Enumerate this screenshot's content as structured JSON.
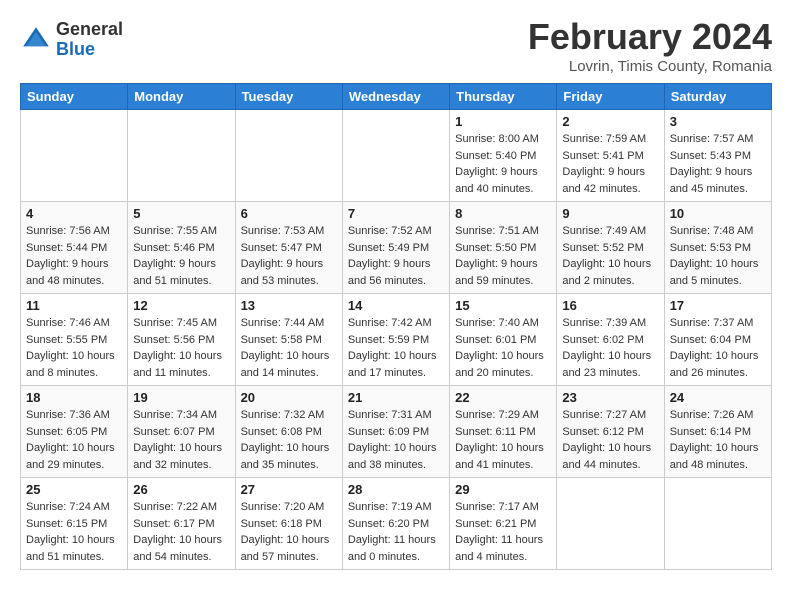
{
  "header": {
    "logo_general": "General",
    "logo_blue": "Blue",
    "title": "February 2024",
    "location": "Lovrin, Timis County, Romania"
  },
  "calendar": {
    "days_of_week": [
      "Sunday",
      "Monday",
      "Tuesday",
      "Wednesday",
      "Thursday",
      "Friday",
      "Saturday"
    ],
    "rows": [
      {
        "cells": [
          {
            "empty": true
          },
          {
            "empty": true
          },
          {
            "empty": true
          },
          {
            "empty": true
          },
          {
            "day": "1",
            "sunrise": "Sunrise: 8:00 AM",
            "sunset": "Sunset: 5:40 PM",
            "daylight": "Daylight: 9 hours and 40 minutes."
          },
          {
            "day": "2",
            "sunrise": "Sunrise: 7:59 AM",
            "sunset": "Sunset: 5:41 PM",
            "daylight": "Daylight: 9 hours and 42 minutes."
          },
          {
            "day": "3",
            "sunrise": "Sunrise: 7:57 AM",
            "sunset": "Sunset: 5:43 PM",
            "daylight": "Daylight: 9 hours and 45 minutes."
          }
        ]
      },
      {
        "cells": [
          {
            "day": "4",
            "sunrise": "Sunrise: 7:56 AM",
            "sunset": "Sunset: 5:44 PM",
            "daylight": "Daylight: 9 hours and 48 minutes."
          },
          {
            "day": "5",
            "sunrise": "Sunrise: 7:55 AM",
            "sunset": "Sunset: 5:46 PM",
            "daylight": "Daylight: 9 hours and 51 minutes."
          },
          {
            "day": "6",
            "sunrise": "Sunrise: 7:53 AM",
            "sunset": "Sunset: 5:47 PM",
            "daylight": "Daylight: 9 hours and 53 minutes."
          },
          {
            "day": "7",
            "sunrise": "Sunrise: 7:52 AM",
            "sunset": "Sunset: 5:49 PM",
            "daylight": "Daylight: 9 hours and 56 minutes."
          },
          {
            "day": "8",
            "sunrise": "Sunrise: 7:51 AM",
            "sunset": "Sunset: 5:50 PM",
            "daylight": "Daylight: 9 hours and 59 minutes."
          },
          {
            "day": "9",
            "sunrise": "Sunrise: 7:49 AM",
            "sunset": "Sunset: 5:52 PM",
            "daylight": "Daylight: 10 hours and 2 minutes."
          },
          {
            "day": "10",
            "sunrise": "Sunrise: 7:48 AM",
            "sunset": "Sunset: 5:53 PM",
            "daylight": "Daylight: 10 hours and 5 minutes."
          }
        ]
      },
      {
        "cells": [
          {
            "day": "11",
            "sunrise": "Sunrise: 7:46 AM",
            "sunset": "Sunset: 5:55 PM",
            "daylight": "Daylight: 10 hours and 8 minutes."
          },
          {
            "day": "12",
            "sunrise": "Sunrise: 7:45 AM",
            "sunset": "Sunset: 5:56 PM",
            "daylight": "Daylight: 10 hours and 11 minutes."
          },
          {
            "day": "13",
            "sunrise": "Sunrise: 7:44 AM",
            "sunset": "Sunset: 5:58 PM",
            "daylight": "Daylight: 10 hours and 14 minutes."
          },
          {
            "day": "14",
            "sunrise": "Sunrise: 7:42 AM",
            "sunset": "Sunset: 5:59 PM",
            "daylight": "Daylight: 10 hours and 17 minutes."
          },
          {
            "day": "15",
            "sunrise": "Sunrise: 7:40 AM",
            "sunset": "Sunset: 6:01 PM",
            "daylight": "Daylight: 10 hours and 20 minutes."
          },
          {
            "day": "16",
            "sunrise": "Sunrise: 7:39 AM",
            "sunset": "Sunset: 6:02 PM",
            "daylight": "Daylight: 10 hours and 23 minutes."
          },
          {
            "day": "17",
            "sunrise": "Sunrise: 7:37 AM",
            "sunset": "Sunset: 6:04 PM",
            "daylight": "Daylight: 10 hours and 26 minutes."
          }
        ]
      },
      {
        "cells": [
          {
            "day": "18",
            "sunrise": "Sunrise: 7:36 AM",
            "sunset": "Sunset: 6:05 PM",
            "daylight": "Daylight: 10 hours and 29 minutes."
          },
          {
            "day": "19",
            "sunrise": "Sunrise: 7:34 AM",
            "sunset": "Sunset: 6:07 PM",
            "daylight": "Daylight: 10 hours and 32 minutes."
          },
          {
            "day": "20",
            "sunrise": "Sunrise: 7:32 AM",
            "sunset": "Sunset: 6:08 PM",
            "daylight": "Daylight: 10 hours and 35 minutes."
          },
          {
            "day": "21",
            "sunrise": "Sunrise: 7:31 AM",
            "sunset": "Sunset: 6:09 PM",
            "daylight": "Daylight: 10 hours and 38 minutes."
          },
          {
            "day": "22",
            "sunrise": "Sunrise: 7:29 AM",
            "sunset": "Sunset: 6:11 PM",
            "daylight": "Daylight: 10 hours and 41 minutes."
          },
          {
            "day": "23",
            "sunrise": "Sunrise: 7:27 AM",
            "sunset": "Sunset: 6:12 PM",
            "daylight": "Daylight: 10 hours and 44 minutes."
          },
          {
            "day": "24",
            "sunrise": "Sunrise: 7:26 AM",
            "sunset": "Sunset: 6:14 PM",
            "daylight": "Daylight: 10 hours and 48 minutes."
          }
        ]
      },
      {
        "cells": [
          {
            "day": "25",
            "sunrise": "Sunrise: 7:24 AM",
            "sunset": "Sunset: 6:15 PM",
            "daylight": "Daylight: 10 hours and 51 minutes."
          },
          {
            "day": "26",
            "sunrise": "Sunrise: 7:22 AM",
            "sunset": "Sunset: 6:17 PM",
            "daylight": "Daylight: 10 hours and 54 minutes."
          },
          {
            "day": "27",
            "sunrise": "Sunrise: 7:20 AM",
            "sunset": "Sunset: 6:18 PM",
            "daylight": "Daylight: 10 hours and 57 minutes."
          },
          {
            "day": "28",
            "sunrise": "Sunrise: 7:19 AM",
            "sunset": "Sunset: 6:20 PM",
            "daylight": "Daylight: 11 hours and 0 minutes."
          },
          {
            "day": "29",
            "sunrise": "Sunrise: 7:17 AM",
            "sunset": "Sunset: 6:21 PM",
            "daylight": "Daylight: 11 hours and 4 minutes."
          },
          {
            "empty": true
          },
          {
            "empty": true
          }
        ]
      }
    ]
  }
}
